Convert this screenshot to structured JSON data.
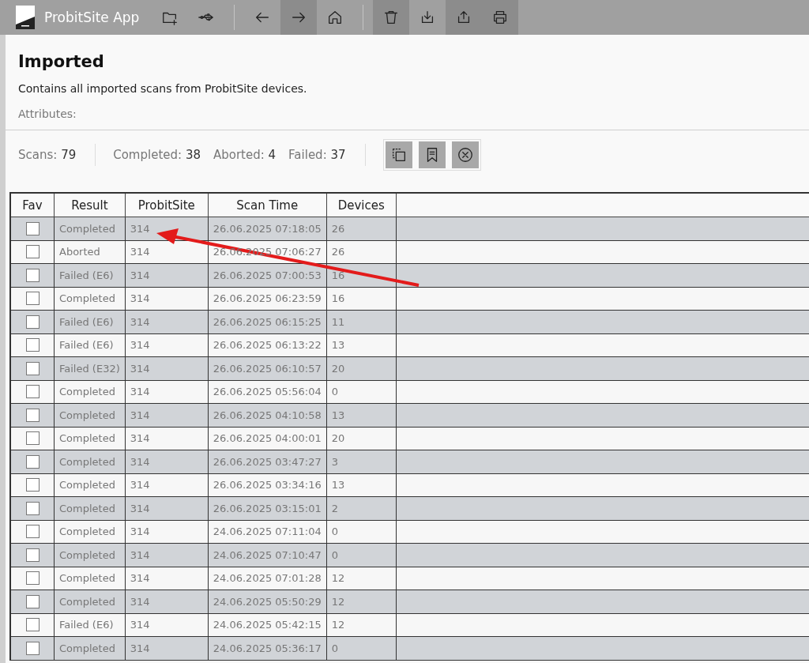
{
  "app": {
    "title": "ProbitSite App"
  },
  "toolbar": [
    {
      "kind": "new-folder",
      "highlighted": false
    },
    {
      "kind": "usb",
      "highlighted": false
    },
    {
      "kind": "separator"
    },
    {
      "kind": "back",
      "highlighted": false
    },
    {
      "kind": "forward",
      "highlighted": true
    },
    {
      "kind": "home",
      "highlighted": false
    },
    {
      "kind": "separator"
    },
    {
      "kind": "delete",
      "highlighted": true
    },
    {
      "kind": "download",
      "highlighted": false
    },
    {
      "kind": "share",
      "highlighted": true
    },
    {
      "kind": "print",
      "highlighted": true
    }
  ],
  "header": {
    "title": "Imported",
    "description": "Contains all imported scans from ProbitSite devices.",
    "attributes_label": "Attributes:"
  },
  "stat_groups": [
    [
      {
        "label": "Scans:",
        "value": "79"
      }
    ],
    [
      {
        "label": "Completed:",
        "value": "38"
      },
      {
        "label": "Aborted:",
        "value": "4"
      },
      {
        "label": "Failed:",
        "value": "37"
      }
    ]
  ],
  "actions": [
    {
      "kind": "select"
    },
    {
      "kind": "bookmark"
    },
    {
      "kind": "cancel"
    }
  ],
  "table": {
    "columns": [
      "Fav",
      "Result",
      "ProbitSite",
      "Scan Time",
      "Devices"
    ],
    "rows": [
      {
        "fav": false,
        "result": "Completed",
        "site": "314",
        "time": "26.06.2025 07:18:05",
        "devices": "26"
      },
      {
        "fav": false,
        "result": "Aborted",
        "site": "314",
        "time": "26.06.2025 07:06:27",
        "devices": "26"
      },
      {
        "fav": false,
        "result": "Failed (E6)",
        "site": "314",
        "time": "26.06.2025 07:00:53",
        "devices": "16"
      },
      {
        "fav": false,
        "result": "Completed",
        "site": "314",
        "time": "26.06.2025 06:23:59",
        "devices": "16"
      },
      {
        "fav": false,
        "result": "Failed (E6)",
        "site": "314",
        "time": "26.06.2025 06:15:25",
        "devices": "11"
      },
      {
        "fav": false,
        "result": "Failed (E6)",
        "site": "314",
        "time": "26.06.2025 06:13:22",
        "devices": "13"
      },
      {
        "fav": false,
        "result": "Failed (E32)",
        "site": "314",
        "time": "26.06.2025 06:10:57",
        "devices": "20"
      },
      {
        "fav": false,
        "result": "Completed",
        "site": "314",
        "time": "26.06.2025 05:56:04",
        "devices": "0"
      },
      {
        "fav": false,
        "result": "Completed",
        "site": "314",
        "time": "26.06.2025 04:10:58",
        "devices": "13"
      },
      {
        "fav": false,
        "result": "Completed",
        "site": "314",
        "time": "26.06.2025 04:00:01",
        "devices": "20"
      },
      {
        "fav": false,
        "result": "Completed",
        "site": "314",
        "time": "26.06.2025 03:47:27",
        "devices": "3"
      },
      {
        "fav": false,
        "result": "Completed",
        "site": "314",
        "time": "26.06.2025 03:34:16",
        "devices": "13"
      },
      {
        "fav": false,
        "result": "Completed",
        "site": "314",
        "time": "26.06.2025 03:15:01",
        "devices": "2"
      },
      {
        "fav": false,
        "result": "Completed",
        "site": "314",
        "time": "24.06.2025 07:11:04",
        "devices": "0"
      },
      {
        "fav": false,
        "result": "Completed",
        "site": "314",
        "time": "24.06.2025 07:10:47",
        "devices": "0"
      },
      {
        "fav": false,
        "result": "Completed",
        "site": "314",
        "time": "24.06.2025 07:01:28",
        "devices": "12"
      },
      {
        "fav": false,
        "result": "Completed",
        "site": "314",
        "time": "24.06.2025 05:50:29",
        "devices": "12"
      },
      {
        "fav": false,
        "result": "Failed (E6)",
        "site": "314",
        "time": "24.06.2025 05:42:15",
        "devices": "12"
      },
      {
        "fav": false,
        "result": "Completed",
        "site": "314",
        "time": "24.06.2025 05:36:17",
        "devices": "0"
      }
    ]
  }
}
